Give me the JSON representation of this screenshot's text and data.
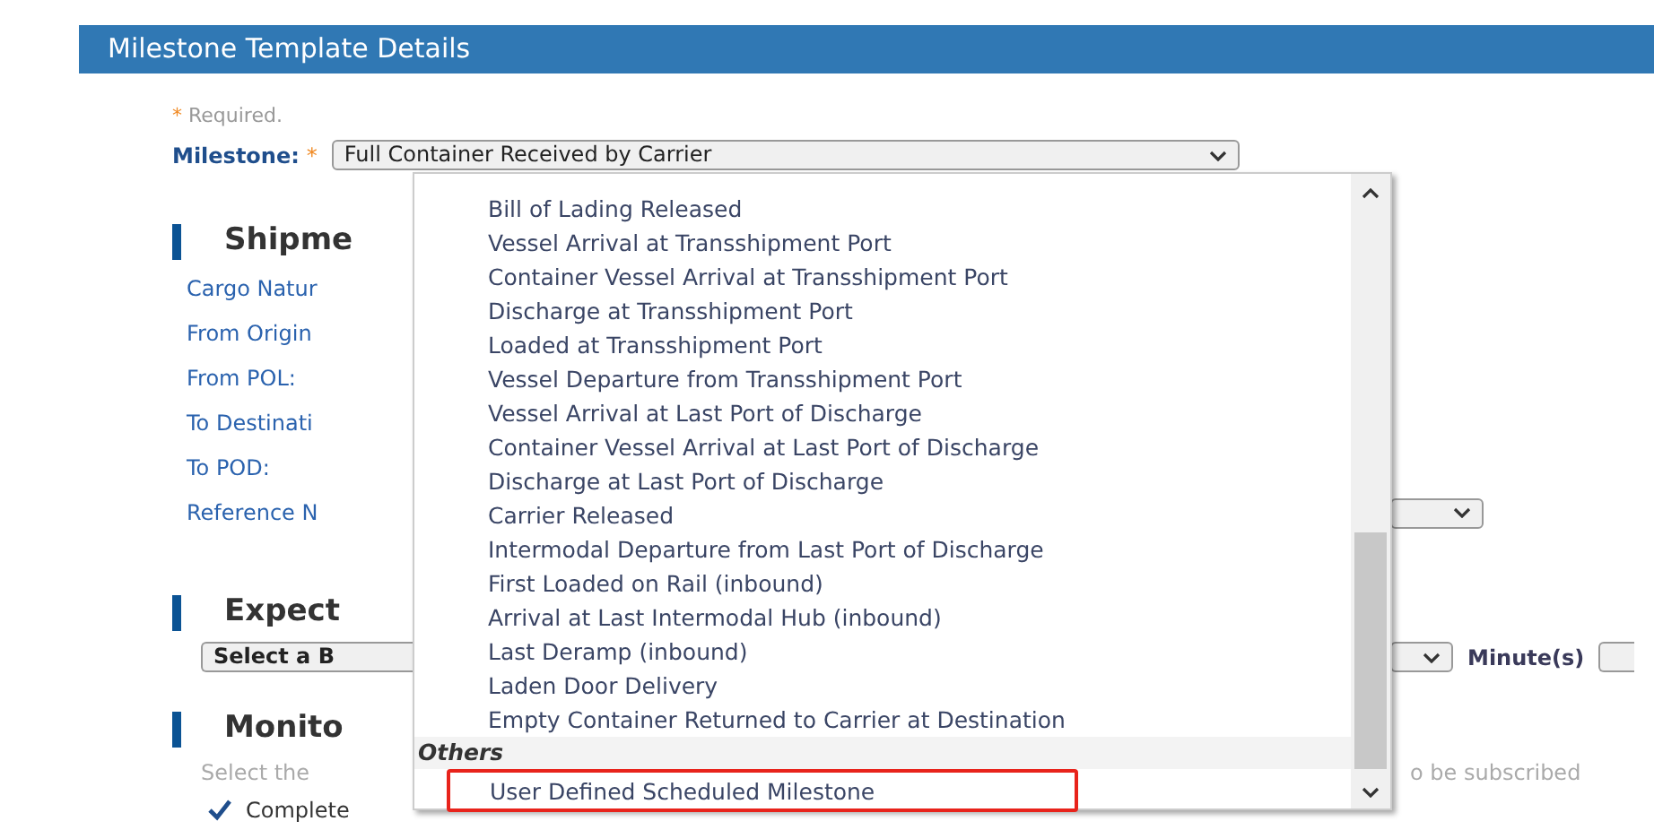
{
  "page_header": {
    "title": "Milestone Template Details"
  },
  "required_note": {
    "marker": "*",
    "text": "Required."
  },
  "milestone": {
    "label": "Milestone:",
    "required_marker": "*",
    "value": "Full Container Received by Carrier"
  },
  "shipment": {
    "title": "Shipme",
    "fields": [
      {
        "label": "Cargo Natur",
        "kind": "text"
      },
      {
        "label": "From Origin",
        "kind": "text"
      },
      {
        "label": "From POL:",
        "kind": "text"
      },
      {
        "label": "To Destinati",
        "kind": "text"
      },
      {
        "label": "To POD:",
        "kind": "text"
      },
      {
        "label": "Reference N",
        "kind": "select"
      }
    ]
  },
  "expected": {
    "title": "Expect",
    "select_value": "Select a B",
    "unit": "Minute(s)"
  },
  "monitor": {
    "title": "Monito",
    "hint_start": "Select the",
    "hint_end": "o be subscribed",
    "checkbox": {
      "label": "Complete",
      "checked": true
    }
  },
  "dropdown": {
    "options": [
      {
        "label": "Bill of Lading Released",
        "highlighted": false
      },
      {
        "label": "Vessel Arrival at Transshipment Port",
        "highlighted": false
      },
      {
        "label": "Container Vessel Arrival at Transshipment Port",
        "highlighted": false
      },
      {
        "label": "Discharge at Transshipment Port",
        "highlighted": false
      },
      {
        "label": "Loaded at Transshipment Port",
        "highlighted": false
      },
      {
        "label": "Vessel Departure from Transshipment Port",
        "highlighted": false
      },
      {
        "label": "Vessel Arrival at Last Port of Discharge",
        "highlighted": false
      },
      {
        "label": "Container Vessel Arrival at Last Port of Discharge",
        "highlighted": false
      },
      {
        "label": "Discharge at Last Port of Discharge",
        "highlighted": false
      },
      {
        "label": "Carrier Released",
        "highlighted": false
      },
      {
        "label": "Intermodal Departure from Last Port of Discharge",
        "highlighted": false
      },
      {
        "label": "First Loaded on Rail (inbound)",
        "highlighted": false
      },
      {
        "label": "Arrival at Last Intermodal Hub (inbound)",
        "highlighted": false
      },
      {
        "label": "Last Deramp (inbound)",
        "highlighted": false
      },
      {
        "label": "Laden Door Delivery",
        "highlighted": false
      },
      {
        "label": "Empty Container Returned to Carrier at Destination",
        "highlighted": false
      }
    ],
    "group": {
      "label": "Others",
      "options": [
        {
          "label": "User Defined Scheduled Milestone",
          "highlighted": true
        }
      ]
    }
  }
}
